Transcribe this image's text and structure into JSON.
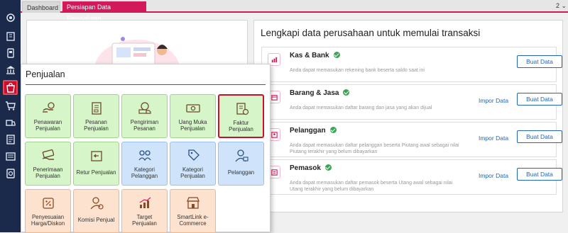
{
  "tabs": {
    "dashboard": "Dashboard",
    "active": "Persiapan Data Perusahaan",
    "more": "2 ⌄"
  },
  "rail": {
    "icons": [
      "settings-icon",
      "company-icon",
      "ledger-icon",
      "bank-icon",
      "sales-icon",
      "purchase-icon",
      "inventory-icon",
      "report-icon",
      "list-icon",
      "shield-icon"
    ],
    "active_index": 4
  },
  "right_panel": {
    "title": "Lengkapi data perusahaan untuk memulai transaksi",
    "rows": [
      {
        "title": "Kas & Bank",
        "desc": "Anda dapat memasukan rekening bank beserta saldo saat ini",
        "impor": "",
        "buat": "Buat Data"
      },
      {
        "title": "Barang & Jasa",
        "desc": "Anda dapat memasukan daftar barang dan jasa yang akan dijual",
        "impor": "Impor Data",
        "buat": "Buat Data"
      },
      {
        "title": "Pelanggan",
        "desc": "Anda dapat memasukan daftar pelanggan beserta Piutang awal sebagai nilai Piutang terakhir yang belum dibayarkan",
        "impor": "Impor Data",
        "buat": "Buat Data"
      },
      {
        "title": "Pemasok",
        "desc": "Anda dapat memasukan daftar pemasok beserta Utang awal sebagai nilai Utang terakhir yang belum dibayarkan",
        "impor": "Impor Data",
        "buat": "Buat Data"
      }
    ]
  },
  "popup": {
    "title": "Penjualan",
    "tiles": [
      {
        "label": "Penawaran\nPenjualan",
        "color": "green",
        "icon": "quote-icon"
      },
      {
        "label": "Pesanan\nPenjualan",
        "color": "green",
        "icon": "order-icon"
      },
      {
        "label": "Pengiriman\nPesanan",
        "color": "green",
        "icon": "delivery-truck-icon"
      },
      {
        "label": "Uang Muka\nPenjualan",
        "color": "green",
        "icon": "cash-icon"
      },
      {
        "label": "Faktur\nPenjualan",
        "color": "green",
        "icon": "invoice-icon",
        "selected": true
      },
      {
        "label": "Penerimaan\nPenjualan",
        "color": "green",
        "icon": "money-receive-icon"
      },
      {
        "label": "Retur Penjualan",
        "color": "green",
        "icon": "return-icon"
      },
      {
        "label": "Kategori\nPelanggan",
        "color": "blue",
        "icon": "customer-category-icon"
      },
      {
        "label": "Kategori\nPenjualan",
        "color": "blue",
        "icon": "tag-icon"
      },
      {
        "label": "Pelanggan",
        "color": "blue",
        "icon": "customer-icon"
      },
      {
        "label": "Penyesuaian\nHarga/Diskon",
        "color": "peach",
        "icon": "discount-icon"
      },
      {
        "label": "Komisi Penjual",
        "color": "peach",
        "icon": "salesperson-icon"
      },
      {
        "label": "Target\nPenjualan",
        "color": "peach",
        "icon": "target-chart-icon"
      },
      {
        "label": "SmartLink e-\nCommerce",
        "color": "peach",
        "icon": "store-icon"
      }
    ]
  }
}
